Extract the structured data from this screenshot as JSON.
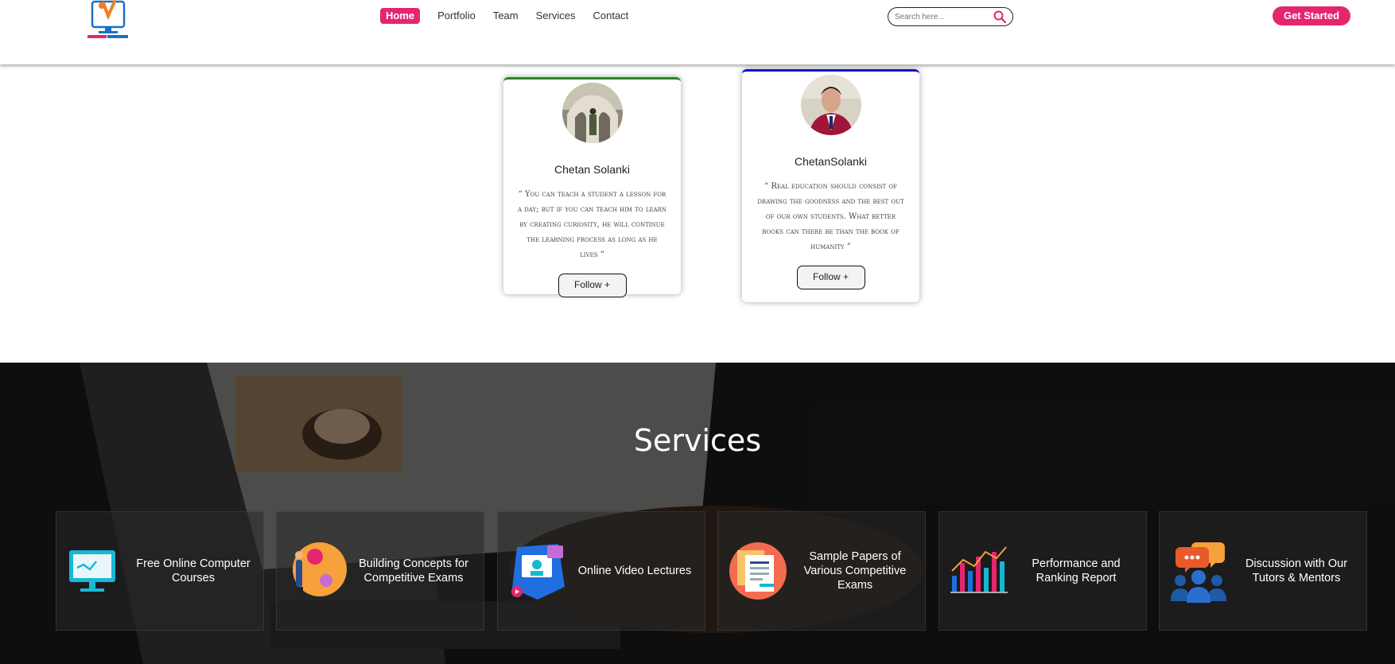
{
  "nav": {
    "links": [
      "Home",
      "Portfolio",
      "Team",
      "Services",
      "Contact"
    ],
    "active_link": "Home",
    "search_placeholder": "Search here...",
    "cta": "Get Started",
    "accent_color": "#e5266f"
  },
  "team": [
    {
      "name": "Chetan Solanki",
      "quote": "“ You can teach a student a lesson for a day; but if you can teach him to learn by creating curiosity, he will continue the learning process as long as he lives ”",
      "follow": "Follow +",
      "accent_color": "#1f8a1f"
    },
    {
      "name": "ChetanSolanki",
      "quote": "“ Real education should consist of drawing the goodness and the best out of our own students. What better books can there be than the book of humanity ”",
      "follow": "Follow +",
      "accent_color": "#1010d0"
    }
  ],
  "services": {
    "title": "Services",
    "items": [
      {
        "label": "Free Online Computer Courses",
        "icon": "computer-monitor-icon"
      },
      {
        "label": "Building Concepts for Competitive Exams",
        "icon": "concept-person-icon"
      },
      {
        "label": "Online Video Lectures",
        "icon": "video-lecture-icon"
      },
      {
        "label": "Sample Papers of Various Competitive Exams",
        "icon": "sample-papers-icon"
      },
      {
        "label": "Performance and Ranking Report",
        "icon": "bar-chart-icon"
      },
      {
        "label": "Discussion with Our Tutors & Mentors",
        "icon": "discussion-group-icon"
      }
    ]
  }
}
